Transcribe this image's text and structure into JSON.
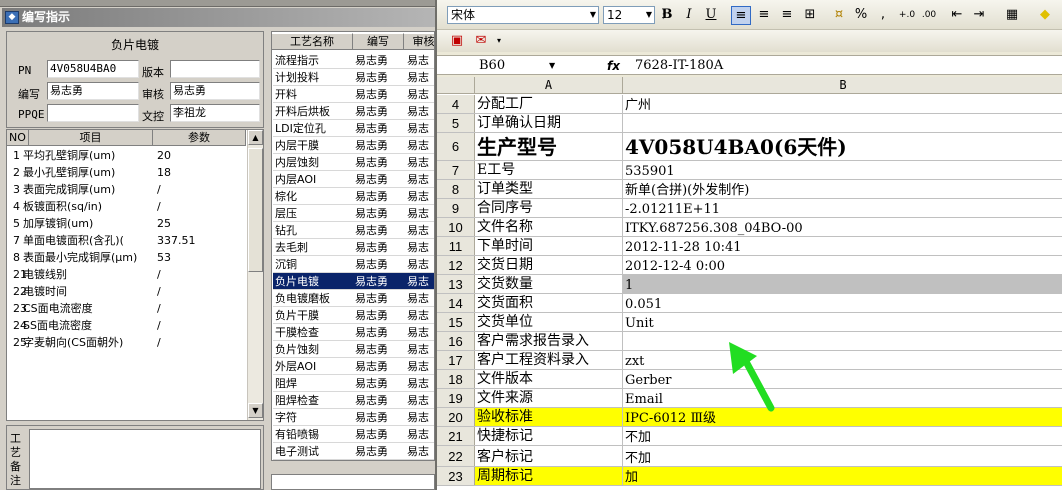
{
  "left_window": {
    "title": "编写指示",
    "panel_title": "负片电镀",
    "fields": {
      "pn_label": "PN",
      "pn_value": "4V058U4BA0",
      "version_label": "版本",
      "version_value": "",
      "writer_label": "编写",
      "writer_value": "易志勇",
      "reviewer_label": "审核",
      "reviewer_value": "易志勇",
      "ppqe_label": "PPQE",
      "ppqe_value": "",
      "doc_control_label": "文控",
      "doc_control_value": "李祖龙"
    },
    "param_headers": [
      "NO",
      "项目",
      "参数"
    ],
    "params": [
      {
        "no": "1",
        "item": "平均孔壁铜厚(um)",
        "value": "20"
      },
      {
        "no": "2",
        "item": "最小孔壁铜厚(um)",
        "value": "18"
      },
      {
        "no": "3",
        "item": "表面完成铜厚(um)",
        "value": "/"
      },
      {
        "no": "4",
        "item": "板镀面积(sq/in)",
        "value": "/"
      },
      {
        "no": "5",
        "item": "加厚镀铜(um)",
        "value": "25"
      },
      {
        "no": "7",
        "item": "单面电镀面积(含孔)(",
        "value": "337.51"
      },
      {
        "no": "8",
        "item": "表面最小完成铜厚(μm)",
        "value": "53"
      },
      {
        "no": "21",
        "item": "电镀线别",
        "value": "/"
      },
      {
        "no": "22",
        "item": "电镀时间",
        "value": "/"
      },
      {
        "no": "23",
        "item": "CS面电流密度",
        "value": "/"
      },
      {
        "no": "24",
        "item": "SS面电流密度",
        "value": "/"
      },
      {
        "no": "25",
        "item": "字麦朝向(CS面朝外)",
        "value": "/"
      }
    ],
    "notes_label": "工艺备注",
    "process_headers": [
      "工艺名称",
      "编写",
      "审核"
    ],
    "processes": [
      {
        "name": "流程指示",
        "writer": "易志勇",
        "reviewer": "易志"
      },
      {
        "name": "计划投料",
        "writer": "易志勇",
        "reviewer": "易志"
      },
      {
        "name": "开料",
        "writer": "易志勇",
        "reviewer": "易志"
      },
      {
        "name": "开料后烘板",
        "writer": "易志勇",
        "reviewer": "易志"
      },
      {
        "name": "LDI定位孔",
        "writer": "易志勇",
        "reviewer": "易志"
      },
      {
        "name": "内层干膜",
        "writer": "易志勇",
        "reviewer": "易志"
      },
      {
        "name": "内层蚀刻",
        "writer": "易志勇",
        "reviewer": "易志"
      },
      {
        "name": "内层AOI",
        "writer": "易志勇",
        "reviewer": "易志"
      },
      {
        "name": "棕化",
        "writer": "易志勇",
        "reviewer": "易志"
      },
      {
        "name": "层压",
        "writer": "易志勇",
        "reviewer": "易志"
      },
      {
        "name": "钻孔",
        "writer": "易志勇",
        "reviewer": "易志"
      },
      {
        "name": "去毛刺",
        "writer": "易志勇",
        "reviewer": "易志"
      },
      {
        "name": "沉铜",
        "writer": "易志勇",
        "reviewer": "易志"
      },
      {
        "name": "负片电镀",
        "writer": "易志勇",
        "reviewer": "易志"
      },
      {
        "name": "负电镀磨板",
        "writer": "易志勇",
        "reviewer": "易志"
      },
      {
        "name": "负片干膜",
        "writer": "易志勇",
        "reviewer": "易志"
      },
      {
        "name": "干膜检查",
        "writer": "易志勇",
        "reviewer": "易志"
      },
      {
        "name": "负片蚀刻",
        "writer": "易志勇",
        "reviewer": "易志"
      },
      {
        "name": "外层AOI",
        "writer": "易志勇",
        "reviewer": "易志"
      },
      {
        "name": "阻焊",
        "writer": "易志勇",
        "reviewer": "易志"
      },
      {
        "name": "阻焊检查",
        "writer": "易志勇",
        "reviewer": "易志"
      },
      {
        "name": "字符",
        "writer": "易志勇",
        "reviewer": "易志"
      },
      {
        "name": "有铅喷锡",
        "writer": "易志勇",
        "reviewer": "易志"
      },
      {
        "name": "电子测试",
        "writer": "易志勇",
        "reviewer": "易志"
      }
    ]
  },
  "excel": {
    "font_name": "宋体",
    "font_size": "12",
    "toolbar_bold": "B",
    "toolbar_italic": "I",
    "toolbar_underline": "U",
    "toolbar_percent": "%",
    "toolbar_comma": ",",
    "name_box": "B60",
    "fx_label": "fx",
    "formula": "7628-IT-180A",
    "col_a": "A",
    "col_b": "B",
    "rows": [
      {
        "num": "4",
        "a": "分配工厂",
        "b": "广州"
      },
      {
        "num": "5",
        "a": "订单确认日期",
        "b": ""
      },
      {
        "num": "6",
        "a": "生产型号",
        "b": "4V058U4BA0(6天件)"
      },
      {
        "num": "7",
        "a": "E工号",
        "b": "535901"
      },
      {
        "num": "8",
        "a": "订单类型",
        "b": "新单(合拼)(外发制作)"
      },
      {
        "num": "9",
        "a": "合同序号",
        "b": "-2.01211E+11"
      },
      {
        "num": "10",
        "a": "文件名称",
        "b": "ITKY.687256.308_04BO-00"
      },
      {
        "num": "11",
        "a": "下单时间",
        "b": "2012-11-28 10:41"
      },
      {
        "num": "12",
        "a": "交货日期",
        "b": "2012-12-4 0:00"
      },
      {
        "num": "13",
        "a": "交货数量",
        "b": "1"
      },
      {
        "num": "14",
        "a": "交货面积",
        "b": "0.051"
      },
      {
        "num": "15",
        "a": "交货单位",
        "b": "Unit"
      },
      {
        "num": "16",
        "a": "客户需求报告录入",
        "b": ""
      },
      {
        "num": "17",
        "a": "客户工程资料录入",
        "b": "zxt"
      },
      {
        "num": "18",
        "a": "文件版本",
        "b": "Gerber"
      },
      {
        "num": "19",
        "a": "文件来源",
        "b": "Email"
      },
      {
        "num": "20",
        "a": "验收标准",
        "b": "IPC-6012 Ⅲ级"
      },
      {
        "num": "21",
        "a": "快捷标记",
        "b": "不加"
      },
      {
        "num": "22",
        "a": "客户标记",
        "b": "不加"
      },
      {
        "num": "23",
        "a": "周期标记",
        "b": "加"
      }
    ],
    "highlight_color": "#ffff00",
    "arrow_color": "#22dd22"
  }
}
